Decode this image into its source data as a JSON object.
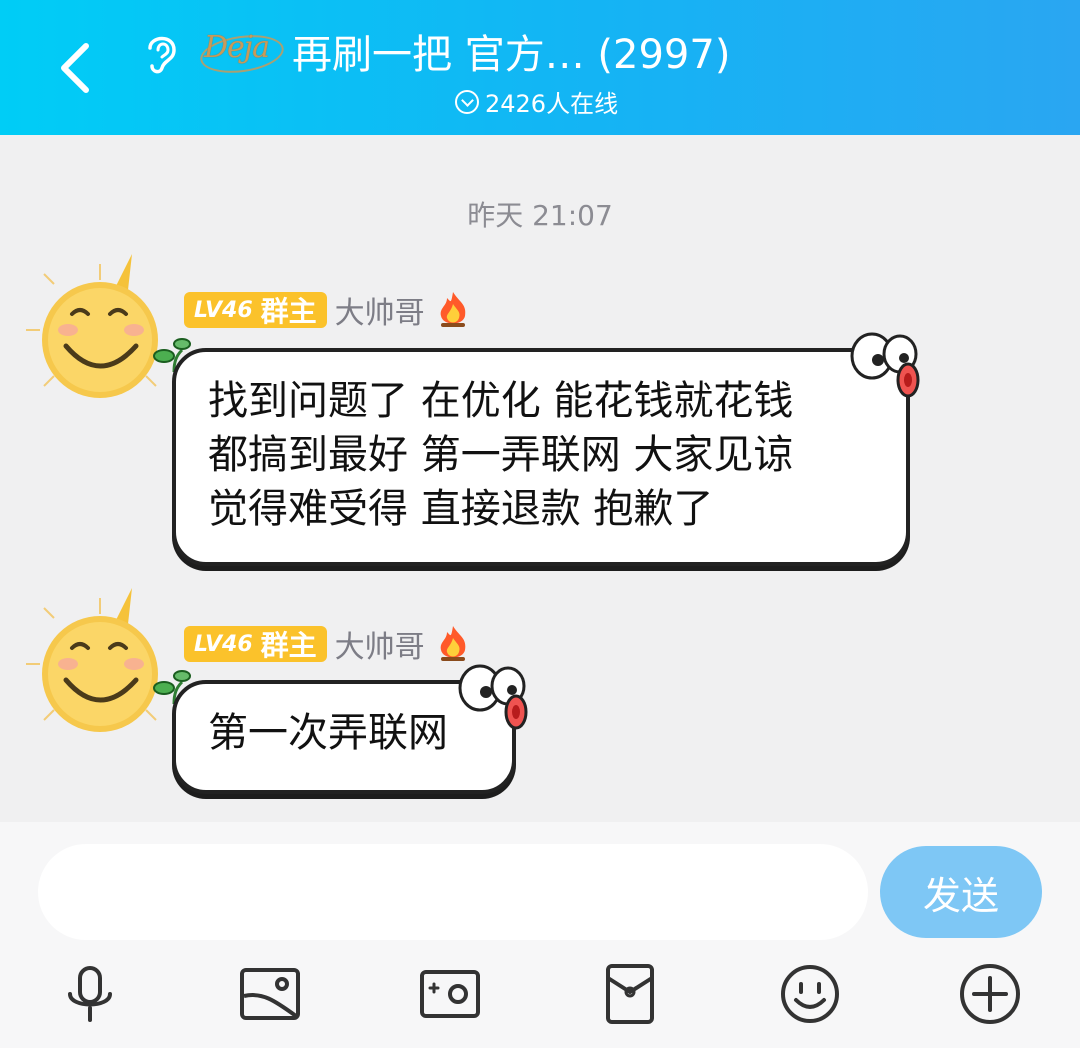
{
  "header": {
    "title": "再刷一把 官方… (2997)",
    "logo_text": "Deja",
    "online_text": "2426人在线",
    "gradient": [
      "#00cdf6",
      "#2aa6f2"
    ]
  },
  "messages": [
    {
      "timestamp": "昨天 21:07",
      "level": "LV46",
      "role": "群主",
      "sender": "大帅哥",
      "lines": [
        "找到问题了 在优化 能花钱就花钱",
        "都搞到最好 第一弄联网 大家见谅",
        "觉得难受得 直接退款 抱歉了"
      ]
    },
    {
      "level": "LV46",
      "role": "群主",
      "sender": "大帅哥",
      "lines": [
        "第一次弄联网"
      ]
    }
  ],
  "input": {
    "placeholder": "",
    "send_label": "发送"
  },
  "toolbar": {
    "icons": [
      "microphone-icon",
      "image-icon",
      "camera-icon",
      "red-packet-icon",
      "emoji-icon",
      "plus-icon"
    ]
  },
  "colors": {
    "badge": "#fbc22b",
    "send_button": "#7ec7f5",
    "background": "#f0f0f1"
  }
}
